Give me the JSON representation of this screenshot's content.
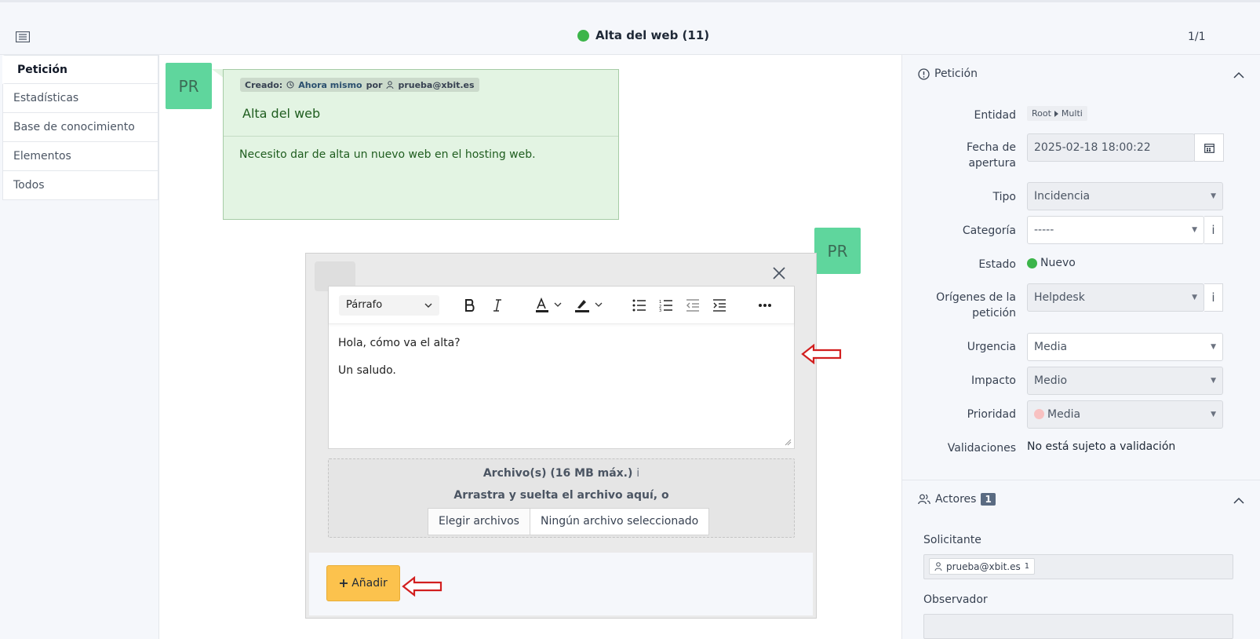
{
  "header": {
    "title": "Alta del web (11)",
    "pager": "1/1",
    "status_color": "#3cb54a"
  },
  "sidebar": {
    "tabs": [
      {
        "label": "Petición",
        "active": true
      },
      {
        "label": "Estadísticas"
      },
      {
        "label": "Base de conocimiento"
      },
      {
        "label": "Elementos"
      },
      {
        "label": "Todos"
      }
    ]
  },
  "timeline": {
    "avatar_initials": "PR",
    "ticket": {
      "created_label": "Creado:",
      "created_when": "Ahora mismo",
      "by_label": "por",
      "author": "prueba@xbit.es",
      "title": "Alta del web",
      "content": "Necesito dar de alta un nuevo web en el hosting web."
    },
    "followup": {
      "avatar_initials": "PR",
      "format_select": "Párrafo",
      "body_lines": [
        "Hola, cómo va el alta?",
        "Un saludo."
      ],
      "files_title": "Archivo(s) (16 MB máx.)",
      "files_info_icon": "i",
      "drag_text": "Arrastra y suelta el archivo aquí, o",
      "choose_files": "Elegir archivos",
      "no_file": "Ningún archivo seleccionado",
      "add_button": "Añadir",
      "add_button_color": "#fcc24d"
    }
  },
  "panel": {
    "section_title": "Petición",
    "fields": {
      "entidad_label": "Entidad",
      "entidad_root": "Root",
      "entidad_child": "Multi",
      "fecha_label": "Fecha de apertura",
      "fecha_value": "2025-02-18 18:00:22",
      "tipo_label": "Tipo",
      "tipo_value": "Incidencia",
      "categoria_label": "Categoría",
      "categoria_value": "-----",
      "estado_label": "Estado",
      "estado_value": "Nuevo",
      "origen_label": "Orígenes de la petición",
      "origen_value": "Helpdesk",
      "urgencia_label": "Urgencia",
      "urgencia_value": "Media",
      "impacto_label": "Impacto",
      "impacto_value": "Medio",
      "prioridad_label": "Prioridad",
      "prioridad_value": "Media",
      "prioridad_color": "#f8c1c1",
      "validaciones_label": "Validaciones",
      "validaciones_value": "No está sujeto a validación",
      "info_glyph": "i"
    },
    "actors": {
      "title": "Actores",
      "count": "1",
      "solicitante_label": "Solicitante",
      "solicitante_value": "prueba@xbit.es",
      "solicitante_count": "1",
      "observador_label": "Observador"
    }
  }
}
